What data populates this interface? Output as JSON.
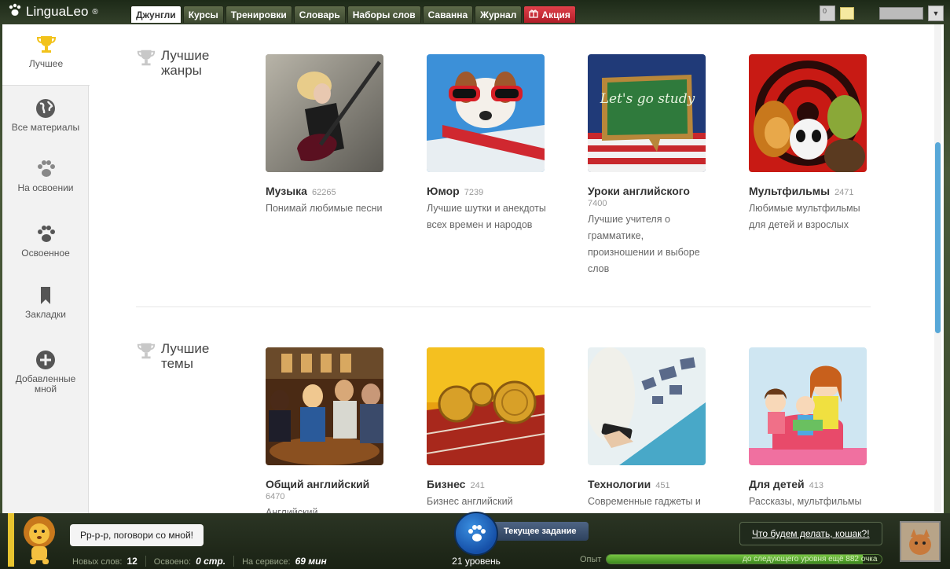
{
  "app": {
    "logo": "LinguaLeo",
    "logo_mark": "®"
  },
  "tabs": [
    {
      "label": "Джунгли",
      "active": true
    },
    {
      "label": "Курсы"
    },
    {
      "label": "Тренировки"
    },
    {
      "label": "Словарь"
    },
    {
      "label": "Наборы слов"
    },
    {
      "label": "Саванна"
    },
    {
      "label": "Журнал"
    },
    {
      "label": "Акция",
      "promo": true
    }
  ],
  "topright": {
    "counter": "0"
  },
  "sidebar": {
    "items": [
      {
        "label": "Лучшее",
        "icon": "trophy-icon",
        "active": true
      },
      {
        "label": "Все материалы",
        "icon": "globe-icon"
      },
      {
        "label": "На освоении",
        "icon": "paw-icon"
      },
      {
        "label": "Освоенное",
        "icon": "paw-icon"
      },
      {
        "label": "Закладки",
        "icon": "bookmark-icon"
      },
      {
        "label": "Добавленные мной",
        "icon": "plus-circle-icon"
      }
    ]
  },
  "sections": {
    "genres": {
      "title_line1": "Лучшие",
      "title_line2": "жанры",
      "cards": [
        {
          "title": "Музыка",
          "count": "62265",
          "desc": "Понимай любимые песни"
        },
        {
          "title": "Юмор",
          "count": "7239",
          "desc": "Лучшие шутки и анекдоты всех времен и народов"
        },
        {
          "title": "Уроки английского",
          "count": "7400",
          "desc": "Лучшие учителя о грамматике, произношении и выборе слов",
          "thumb_text": "Let's go study"
        },
        {
          "title": "Мультфильмы",
          "count": "2471",
          "desc": "Любимые мультфильмы для детей и взрослых"
        }
      ]
    },
    "topics": {
      "title_line1": "Лучшие",
      "title_line2": "темы",
      "cards": [
        {
          "title": "Общий английский",
          "count": "6470",
          "desc": "Английский"
        },
        {
          "title": "Бизнес",
          "count": "241",
          "desc": "Бизнес английский"
        },
        {
          "title": "Технологии",
          "count": "451",
          "desc": "Современные гаджеты и"
        },
        {
          "title": "Для детей",
          "count": "413",
          "desc": "Рассказы, мультфильмы"
        }
      ]
    }
  },
  "bottombar": {
    "bubble": "Рр-р-р, поговори со мной!",
    "stats": {
      "new_words_label": "Новых слов:",
      "new_words": "12",
      "learned_label": "Освоено:",
      "learned": "0 стр.",
      "service_label": "На сервисе:",
      "service": "69 мин"
    },
    "task_label": "Текущее задание",
    "level": "21 уровень",
    "xp_label": "Опыт",
    "xp_progress": 0.93,
    "xp_text": "до следующего уровня ещё 882 очка",
    "cat_question": "Что будем делать, кошак?!"
  }
}
